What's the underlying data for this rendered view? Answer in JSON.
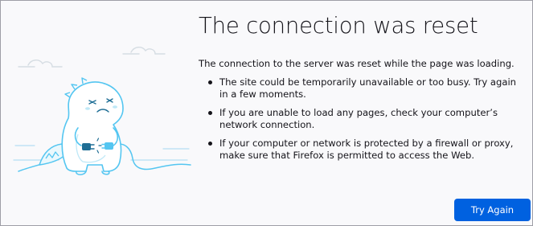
{
  "error_page": {
    "title": "The connection was reset",
    "lead": "The connection to the server was reset while the page was loading.",
    "reasons": [
      "The site could be temporarily unavailable or too busy. Try again in a few moments.",
      "If you are unable to load any pages, check your computer’s network connection.",
      "If your computer or network is protected by a firewall or proxy, make sure that Firefox is permitted to access the Web."
    ],
    "try_again_label": "Try Again",
    "illustration_icon": "dino-unplugged-cable-illustration",
    "accent_color": "#0061e0",
    "illustration_color": "#54c6f1"
  }
}
